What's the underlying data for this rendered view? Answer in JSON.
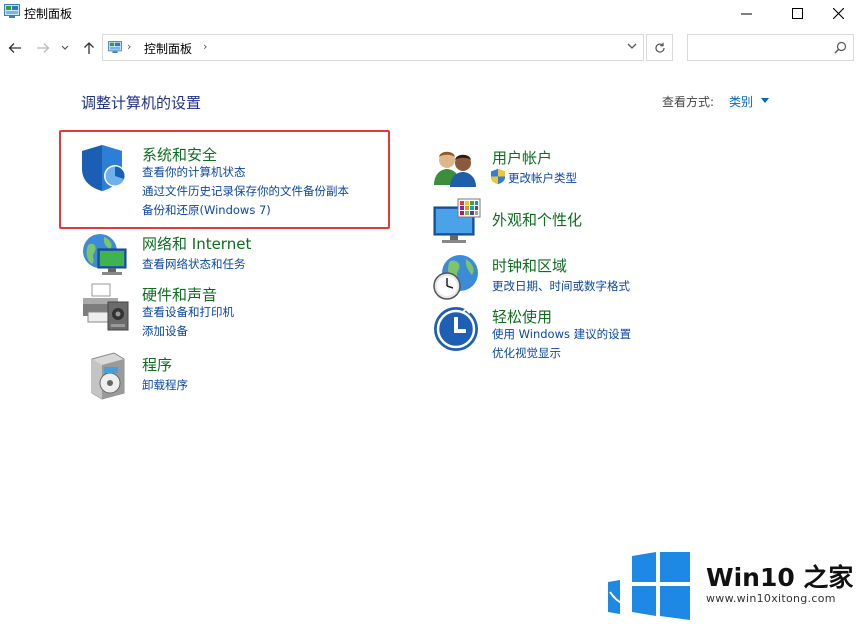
{
  "window": {
    "title": "控制面板"
  },
  "address": {
    "path": "控制面板",
    "chevron": "›"
  },
  "search": {
    "placeholder": ""
  },
  "main": {
    "heading": "调整计算机的设置",
    "view_by_label": "查看方式:",
    "view_by_value": "类别"
  },
  "categories": {
    "system": {
      "title": "系统和安全",
      "links": [
        "查看你的计算机状态",
        "通过文件历史记录保存你的文件备份副本",
        "备份和还原(Windows 7)"
      ]
    },
    "network": {
      "title": "网络和 Internet",
      "links": [
        "查看网络状态和任务"
      ]
    },
    "hardware": {
      "title": "硬件和声音",
      "links": [
        "查看设备和打印机",
        "添加设备"
      ]
    },
    "programs": {
      "title": "程序",
      "links": [
        "卸载程序"
      ]
    },
    "users": {
      "title": "用户帐户",
      "links": [
        "更改帐户类型"
      ]
    },
    "appearance": {
      "title": "外观和个性化",
      "links": []
    },
    "clock": {
      "title": "时钟和区域",
      "links": [
        "更改日期、时间或数字格式"
      ]
    },
    "ease": {
      "title": "轻松使用",
      "links": [
        "使用 Windows 建议的设置",
        "优化视觉显示"
      ]
    }
  },
  "watermark": {
    "brand": "Win10 之家",
    "url": "www.win10xitong.com"
  },
  "colors": {
    "category_title": "#0d6e1f",
    "link": "#0b47a8",
    "heading": "#1e3287",
    "highlight_border": "#e53935",
    "accent": "#0078d7"
  },
  "icons": [
    "control-panel-icon",
    "back-arrow-icon",
    "forward-arrow-icon",
    "recent-dropdown-icon",
    "up-arrow-icon",
    "refresh-icon",
    "search-icon",
    "minimize-icon",
    "maximize-icon",
    "close-icon",
    "shield-icon",
    "globe-network-icon",
    "printer-icon",
    "programs-icon",
    "users-icon",
    "display-icon",
    "clock-globe-icon",
    "ease-of-access-icon",
    "uac-shield-icon",
    "windows-logo-icon"
  ]
}
